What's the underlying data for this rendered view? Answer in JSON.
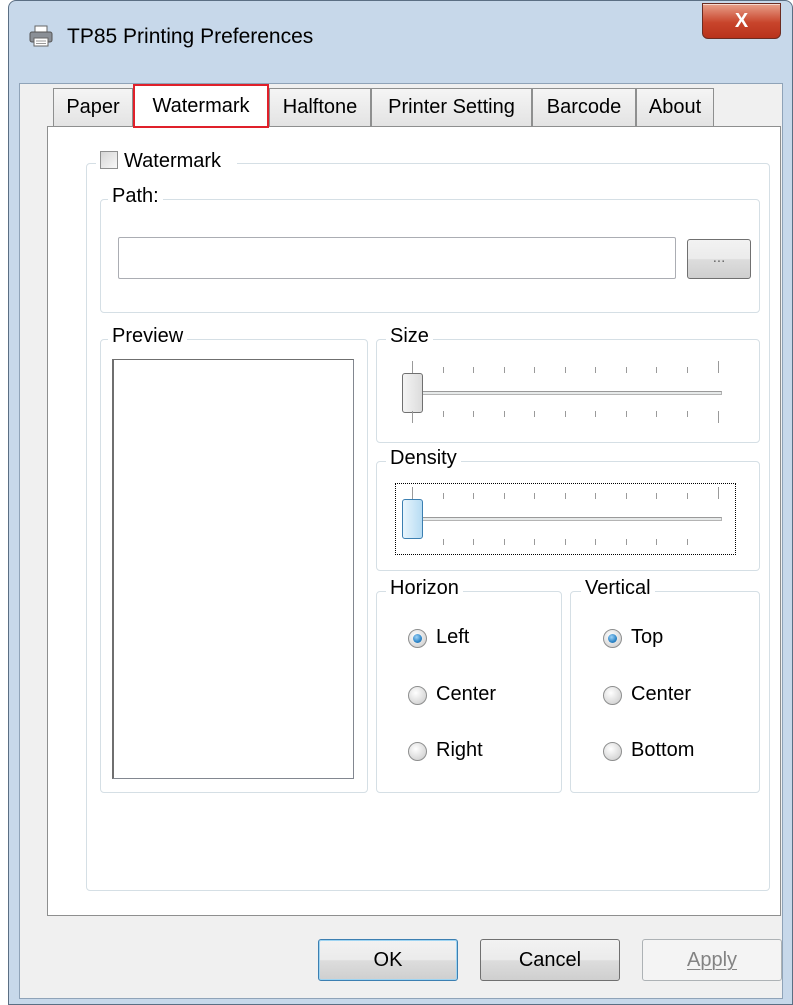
{
  "window": {
    "title": "TP85 Printing Preferences",
    "close_label": "X"
  },
  "tabs": [
    {
      "label": "Paper",
      "active": false
    },
    {
      "label": "Watermark",
      "active": true
    },
    {
      "label": "Halftone",
      "active": false
    },
    {
      "label": "Printer Setting",
      "active": false
    },
    {
      "label": "Barcode",
      "active": false
    },
    {
      "label": "About",
      "active": false
    }
  ],
  "watermark": {
    "enable_label": "Watermark",
    "enabled": false,
    "path_label": "Path:",
    "path_value": "",
    "browse_label": "..."
  },
  "preview": {
    "label": "Preview"
  },
  "size": {
    "label": "Size",
    "level": 0
  },
  "density": {
    "label": "Density",
    "level": 0
  },
  "horizon": {
    "label": "Horizon",
    "options": [
      {
        "label": "Left",
        "checked": true
      },
      {
        "label": "Center",
        "checked": false
      },
      {
        "label": "Right",
        "checked": false
      }
    ]
  },
  "vertical": {
    "label": "Vertical",
    "options": [
      {
        "label": "Top",
        "checked": true
      },
      {
        "label": "Center",
        "checked": false
      },
      {
        "label": "Bottom",
        "checked": false
      }
    ]
  },
  "buttons": {
    "ok": "OK",
    "cancel": "Cancel",
    "apply": "Apply"
  },
  "colors": {
    "frame": "#c7d8ea",
    "accent": "#2e86c8",
    "close": "#c8442b",
    "active_tab_outline": "#e0202a"
  }
}
